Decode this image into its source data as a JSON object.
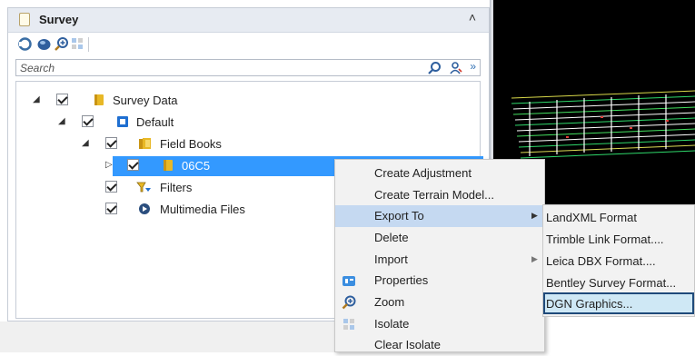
{
  "panel": {
    "title": "Survey",
    "search": {
      "placeholder": "Search"
    },
    "tree": [
      {
        "label": "Survey Data",
        "icon": "survey-data-icon",
        "expander": "◢"
      },
      {
        "label": "Default",
        "icon": "default-icon",
        "expander": "◢"
      },
      {
        "label": "Field Books",
        "icon": "field-books-icon",
        "expander": "◢"
      },
      {
        "label": "06C5",
        "icon": "field-book-icon",
        "expander": "▷",
        "selected": true
      },
      {
        "label": "Filters",
        "icon": "filters-icon"
      },
      {
        "label": "Multimedia Files",
        "icon": "multimedia-icon"
      }
    ]
  },
  "context_menu": {
    "items": [
      {
        "label": "Create Adjustment"
      },
      {
        "label": "Create Terrain Model..."
      },
      {
        "label": "Export To",
        "has_submenu": true,
        "highlighted": true
      },
      {
        "label": "Delete"
      },
      {
        "label": "Import",
        "has_submenu": true
      },
      {
        "label": "Properties",
        "icon": "properties-icon"
      },
      {
        "label": "Zoom",
        "icon": "zoom-icon"
      },
      {
        "label": "Isolate",
        "icon": "isolate-icon"
      },
      {
        "label": "Clear Isolate"
      }
    ]
  },
  "submenu": {
    "items": [
      {
        "label": "LandXML Format"
      },
      {
        "label": "Trimble Link Format...."
      },
      {
        "label": "Leica DBX Format...."
      },
      {
        "label": "Bentley Survey Format..."
      },
      {
        "label": "DGN Graphics...",
        "highlighted": true
      }
    ]
  },
  "colors": {
    "selection": "#3399ff",
    "menu_highlight": "#c5d9f1",
    "submenu_highlight": "#cfe8f5",
    "viewport": "#000000"
  }
}
